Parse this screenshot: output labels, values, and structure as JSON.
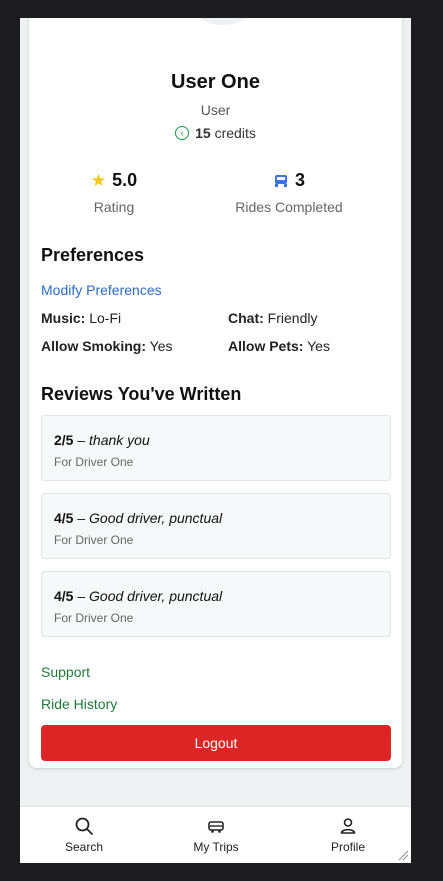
{
  "profile": {
    "name": "User One",
    "role": "User",
    "credits_value": "15",
    "credits_label": "credits"
  },
  "stats": {
    "rating_value": "5.0",
    "rating_label": "Rating",
    "rides_value": "3",
    "rides_label": "Rides Completed"
  },
  "preferences": {
    "title": "Preferences",
    "modify_link": "Modify Preferences",
    "music_label": "Music:",
    "music_value": "Lo-Fi",
    "chat_label": "Chat:",
    "chat_value": "Friendly",
    "smoking_label": "Allow Smoking:",
    "smoking_value": "Yes",
    "pets_label": "Allow Pets:",
    "pets_value": "Yes"
  },
  "reviews": {
    "title": "Reviews You've Written",
    "items": [
      {
        "score": "2/5",
        "separator": "–",
        "comment": "thank you",
        "for": "For Driver One"
      },
      {
        "score": "4/5",
        "separator": "–",
        "comment": "Good driver, punctual",
        "for": "For Driver One"
      },
      {
        "score": "4/5",
        "separator": "–",
        "comment": "Good driver, punctual",
        "for": "For Driver One"
      }
    ]
  },
  "links": {
    "support": "Support",
    "ride_history": "Ride History",
    "logout": "Logout"
  },
  "nav": {
    "search": "Search",
    "trips": "My Trips",
    "profile": "Profile"
  },
  "colors": {
    "logout_bg": "#dc2626",
    "link_blue": "#2b6cc4",
    "link_green": "#1f7a3a",
    "star": "#f5c518",
    "credit_icon": "#1a9a4a",
    "rides_icon": "#3b73d9"
  },
  "icons": [
    "credit-coin-icon",
    "star-icon",
    "car-icon",
    "search-icon",
    "trips-car-icon",
    "profile-icon",
    "resize-handle-icon"
  ]
}
